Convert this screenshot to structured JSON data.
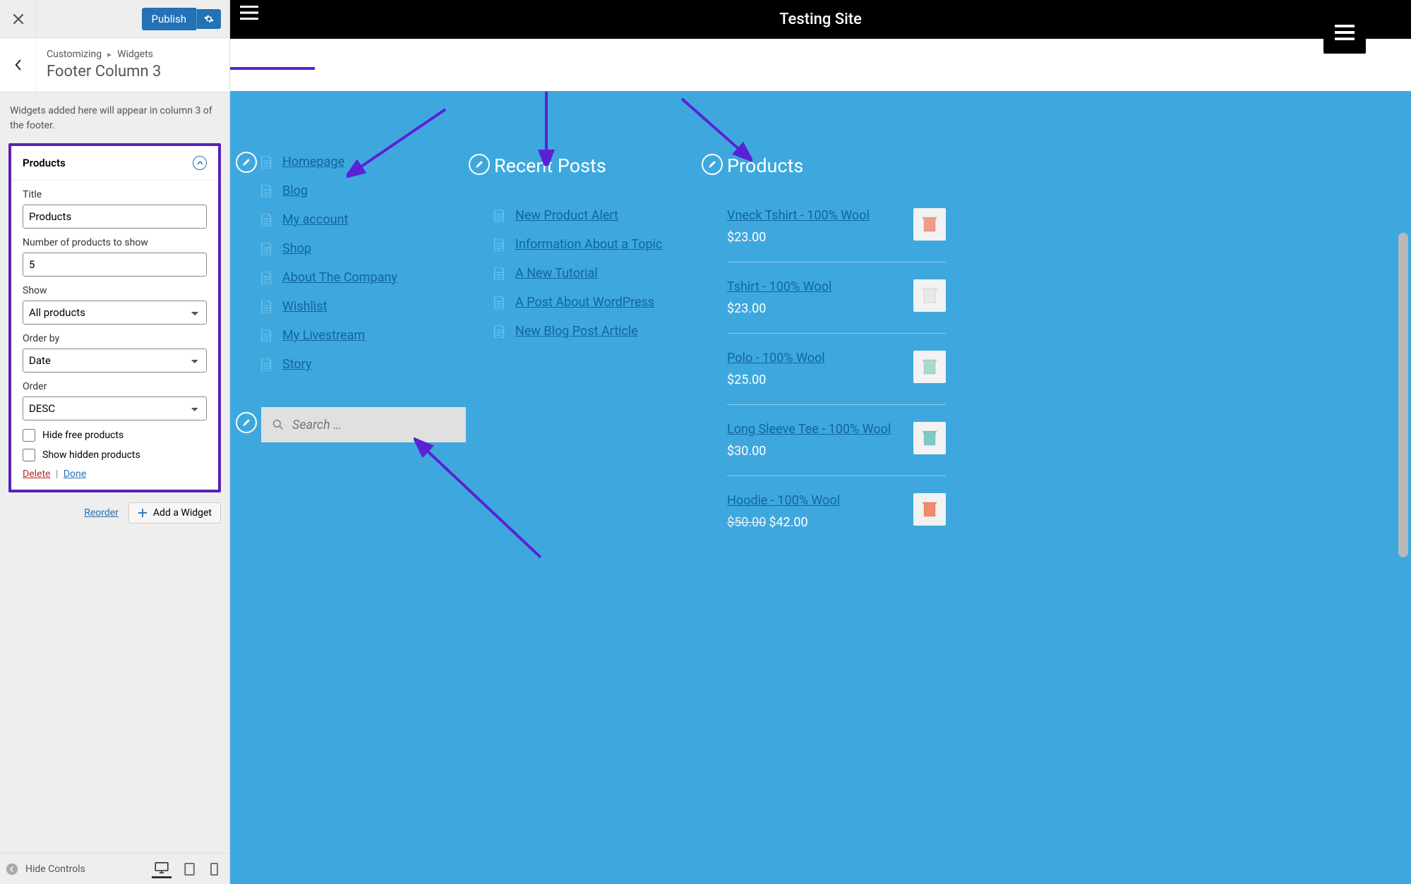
{
  "customizer": {
    "close_label": "Close",
    "publish_label": "Publish",
    "back_breadcrumb_root": "Customizing",
    "back_breadcrumb_parent": "Widgets",
    "section_title": "Footer Column 3",
    "help_text": "Widgets added here will appear in column 3 of the footer.",
    "widget": {
      "name": "Products",
      "fields": {
        "title_label": "Title",
        "title_value": "Products",
        "num_label": "Number of products to show",
        "num_value": "5",
        "show_label": "Show",
        "show_value": "All products",
        "orderby_label": "Order by",
        "orderby_value": "Date",
        "order_label": "Order",
        "order_value": "DESC",
        "hide_free_label": "Hide free products",
        "show_hidden_label": "Show hidden products"
      },
      "delete_label": "Delete",
      "done_label": "Done"
    },
    "reorder_label": "Reorder",
    "add_widget_label": "Add a Widget",
    "hide_controls_label": "Hide Controls"
  },
  "preview": {
    "site_title": "Testing Site",
    "col1": {
      "items": [
        "Homepage",
        "Blog",
        "My account",
        "Shop",
        "About The Company",
        "Wishlist",
        "My Livestream",
        "Story"
      ]
    },
    "col2": {
      "heading": "Recent Posts",
      "items": [
        "New Product Alert",
        "Information About a Topic",
        "A New Tutorial",
        "A Post About WordPress",
        "New Blog Post Article"
      ]
    },
    "col3": {
      "heading": "Products",
      "items": [
        {
          "title": "Vneck Tshirt - 100% Wool",
          "price": "$23.00",
          "color": "#f29b89"
        },
        {
          "title": "Tshirt - 100% Wool",
          "price": "$23.00",
          "color": "#e8e8e8"
        },
        {
          "title": "Polo - 100% Wool",
          "price": "$25.00",
          "color": "#a8d8d0"
        },
        {
          "title": "Long Sleeve Tee - 100% Wool",
          "price": "$30.00",
          "color": "#7fc9c4"
        },
        {
          "title": "Hoodie - 100% Wool",
          "price": "$42.00",
          "old": "$50.00",
          "color": "#f08a6c"
        }
      ]
    },
    "search_placeholder": "Search …"
  }
}
